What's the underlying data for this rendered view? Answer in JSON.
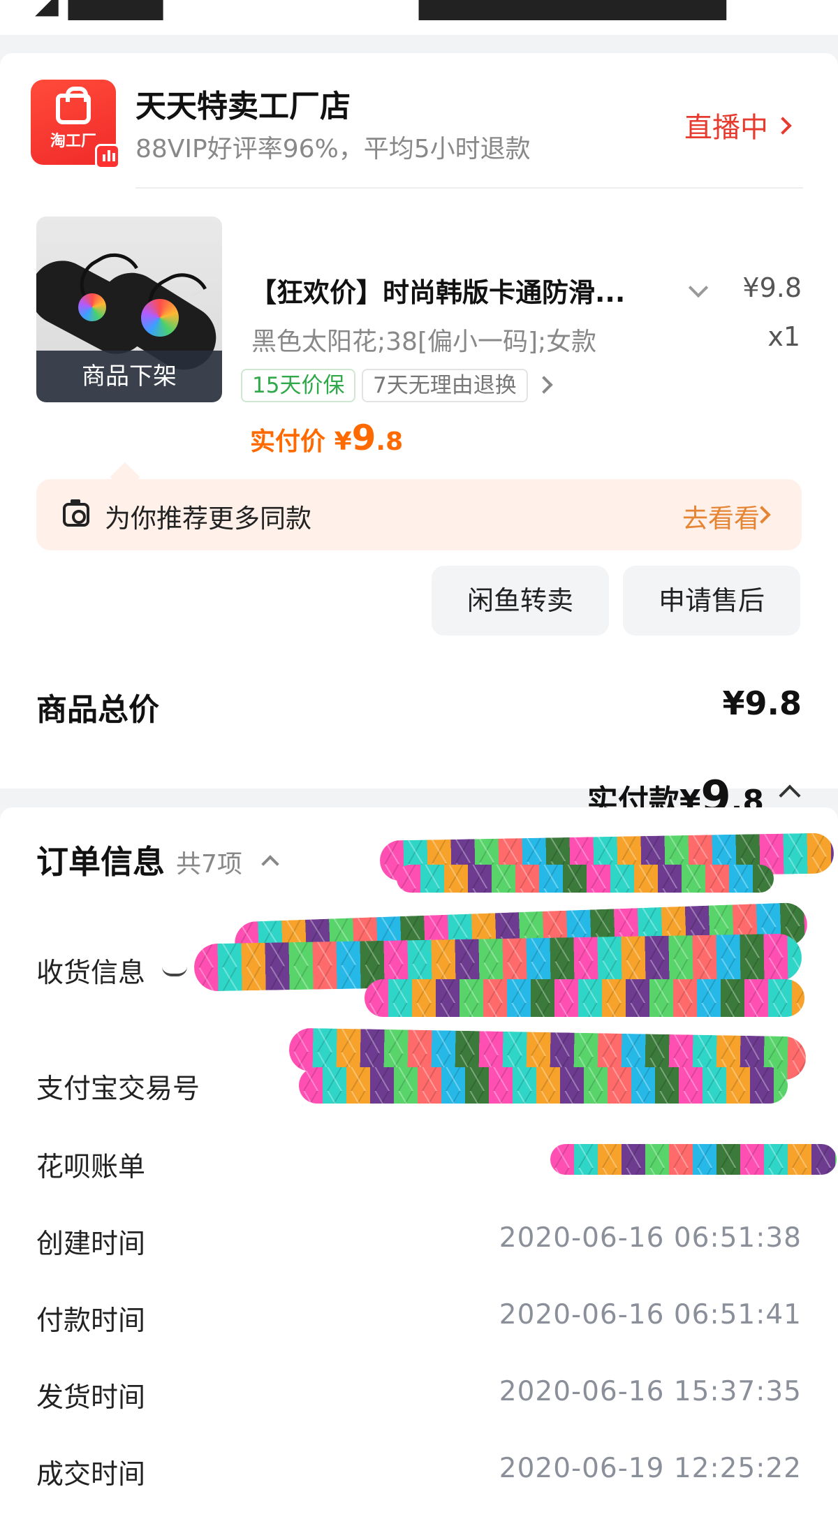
{
  "shop": {
    "logo_text": "淘工厂",
    "name": "天天特卖工厂店",
    "subtitle": "88VIP好评率96%，平均5小时退款",
    "live_label": "直播中"
  },
  "product": {
    "image_overlay": "商品下架",
    "title": "【狂欢价】时尚韩版卡通防滑...",
    "price": "¥9.8",
    "spec": "黑色太阳花;38[偏小一码];女款",
    "quantity": "x1",
    "tags": [
      "15天价保",
      "7天无理由退换"
    ],
    "actual_label": "实付价",
    "actual_currency": "¥",
    "actual_int": "9",
    "actual_dec": ".8"
  },
  "recommend": {
    "label": "为你推荐更多同款",
    "action": "去看看"
  },
  "actions": {
    "resell": "闲鱼转卖",
    "after_sale": "申请售后"
  },
  "totals": {
    "goods_label": "商品总价",
    "goods_value": "¥9.8",
    "paid_label": "实付款",
    "paid_currency": "¥",
    "paid_int": "9",
    "paid_dec": ".8"
  },
  "order_info": {
    "title": "订单信息",
    "count": "共7项",
    "rows": [
      {
        "label": "收货信息",
        "value": ""
      },
      {
        "label": "支付宝交易号",
        "value": ""
      },
      {
        "label": "花呗账单",
        "value": ""
      },
      {
        "label": "创建时间",
        "value": "2020-06-16 06:51:38"
      },
      {
        "label": "付款时间",
        "value": "2020-06-16 06:51:41"
      },
      {
        "label": "发货时间",
        "value": "2020-06-16 15:37:35"
      },
      {
        "label": "成交时间",
        "value": "2020-06-19 12:25:22"
      }
    ]
  },
  "colors": {
    "live_red": "#e63b2e",
    "price_orange": "#ff6a00",
    "tag_green": "#31a84a",
    "banner_bg": "#fff1ea"
  }
}
